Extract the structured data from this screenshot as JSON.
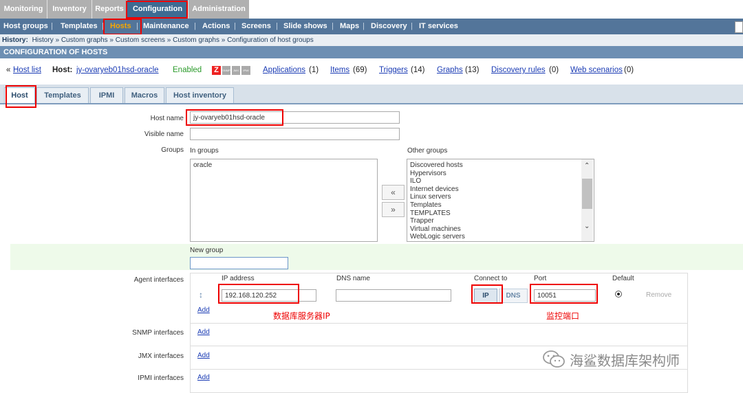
{
  "top_menu": [
    "Monitoring",
    "Inventory",
    "Reports",
    "Configuration",
    "Administration"
  ],
  "sub_menu": [
    "Host groups",
    "Templates",
    "Hosts",
    "Maintenance",
    "Actions",
    "Screens",
    "Slide shows",
    "Maps",
    "Discovery",
    "IT services"
  ],
  "history": {
    "label": "History:",
    "items": [
      "History",
      "Custom graphs",
      "Custom screens",
      "Custom graphs",
      "Configuration of host groups"
    ],
    "separator": "»"
  },
  "page_title": "CONFIGURATION OF HOSTS",
  "host_info": {
    "back_prefix": "«",
    "host_list": "Host list",
    "host_label": "Host:",
    "host_name": "jy-ovaryeb01hsd-oracle",
    "status": "Enabled",
    "badges": [
      "Z",
      "SNMP",
      "JMX",
      "IPMI"
    ],
    "links": [
      {
        "label": "Applications",
        "count": "(1)"
      },
      {
        "label": "Items",
        "count": "(69)"
      },
      {
        "label": "Triggers",
        "count": "(14)"
      },
      {
        "label": "Graphs",
        "count": "(13)"
      },
      {
        "label": "Discovery rules",
        "count": "(0)"
      },
      {
        "label": "Web scenarios",
        "count": "(0)"
      }
    ]
  },
  "tabs": [
    "Host",
    "Templates",
    "IPMI",
    "Macros",
    "Host inventory"
  ],
  "form": {
    "host_name_label": "Host name",
    "host_name_value": "jy-ovaryeb01hsd-oracle",
    "visible_name_label": "Visible name",
    "visible_name_value": "",
    "groups_label": "Groups",
    "in_groups_label": "In groups",
    "in_groups": [
      "oracle"
    ],
    "other_groups_label": "Other groups",
    "other_groups": [
      "Discovered hosts",
      "Hypervisors",
      "ILO",
      "Internet devices",
      "Linux servers",
      "Templates",
      "TEMPLATES",
      "Trapper",
      "Virtual machines",
      "WebLogic servers"
    ],
    "move_left": "«",
    "move_right": "»",
    "new_group_label": "New group",
    "new_group_value": "",
    "agent_interfaces_label": "Agent interfaces",
    "col_ip": "IP address",
    "col_dns": "DNS name",
    "col_connect": "Connect to",
    "col_port": "Port",
    "col_default": "Default",
    "ip_value": "192.168.120.252",
    "dns_value": "",
    "connect_ip": "IP",
    "connect_dns": "DNS",
    "port_value": "10051",
    "remove_label": "Remove",
    "add_label": "Add",
    "snmp_label": "SNMP interfaces",
    "jmx_label": "JMX interfaces",
    "ipmi_label": "IPMI interfaces"
  },
  "annotations": {
    "ip_note": "数据库服务器IP",
    "port_note": "监控端口"
  },
  "watermark": "海鲨数据库架构师",
  "colors": {
    "top_menu_active": "#3e6b92",
    "sub_menu_bg": "#53759a",
    "header_bg": "#6d8fb3",
    "enabled_green": "#2a9a2a",
    "annotation_red": "#e00000"
  }
}
